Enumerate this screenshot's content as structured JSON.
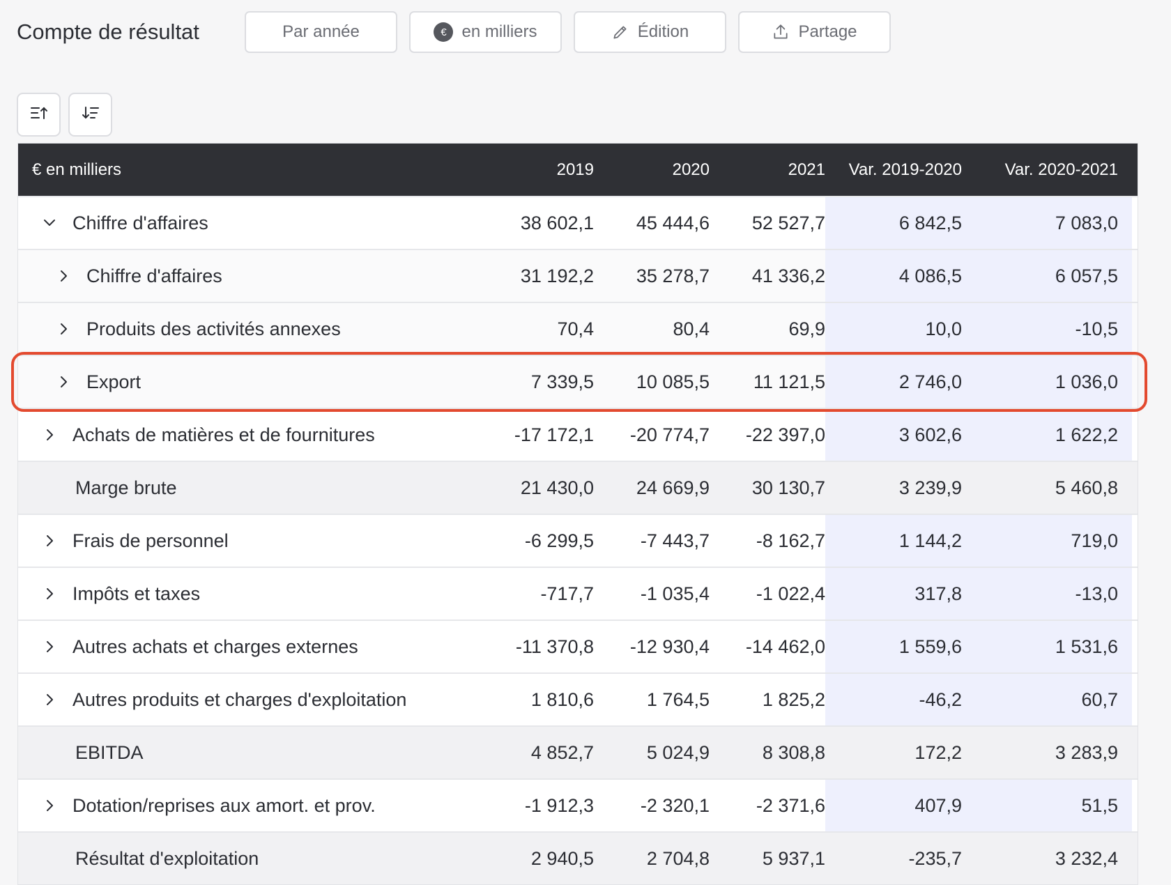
{
  "header": {
    "title": "Compte de résultat",
    "buttons": {
      "period": "Par année",
      "unit": "en milliers",
      "unit_symbol": "€",
      "edit": "Édition",
      "share": "Partage"
    }
  },
  "sort": {
    "ascending_icon": "sort-ascending-icon",
    "descending_icon": "sort-descending-icon"
  },
  "table": {
    "columns": [
      "€ en milliers",
      "2019",
      "2020",
      "2021",
      "Var. 2019-2020",
      "Var. 2020-2021"
    ],
    "rows": [
      {
        "label": "Chiffre d'affaires",
        "v": [
          "38 602,1",
          "45 444,6",
          "52 527,7",
          "6 842,5",
          "7 083,0"
        ]
      },
      {
        "label": "Chiffre d'affaires",
        "v": [
          "31 192,2",
          "35 278,7",
          "41 336,2",
          "4 086,5",
          "6 057,5"
        ]
      },
      {
        "label": "Produits des activités annexes",
        "v": [
          "70,4",
          "80,4",
          "69,9",
          "10,0",
          "-10,5"
        ]
      },
      {
        "label": "Export",
        "v": [
          "7 339,5",
          "10 085,5",
          "11 121,5",
          "2 746,0",
          "1 036,0"
        ]
      },
      {
        "label": "Achats de matières et de fournitures",
        "v": [
          "-17 172,1",
          "-20 774,7",
          "-22 397,0",
          "3 602,6",
          "1 622,2"
        ]
      },
      {
        "label": "Marge brute",
        "v": [
          "21 430,0",
          "24 669,9",
          "30 130,7",
          "3 239,9",
          "5 460,8"
        ]
      },
      {
        "label": "Frais de personnel",
        "v": [
          "-6 299,5",
          "-7 443,7",
          "-8 162,7",
          "1 144,2",
          "719,0"
        ]
      },
      {
        "label": "Impôts et taxes",
        "v": [
          "-717,7",
          "-1 035,4",
          "-1 022,4",
          "317,8",
          "-13,0"
        ]
      },
      {
        "label": "Autres achats et charges externes",
        "v": [
          "-11 370,8",
          "-12 930,4",
          "-14 462,0",
          "1 559,6",
          "1 531,6"
        ]
      },
      {
        "label": "Autres produits et charges d'exploitation",
        "v": [
          "1 810,6",
          "1 764,5",
          "1 825,2",
          "-46,2",
          "60,7"
        ]
      },
      {
        "label": "EBITDA",
        "v": [
          "4 852,7",
          "5 024,9",
          "8 308,8",
          "172,2",
          "3 283,9"
        ]
      },
      {
        "label": "Dotation/reprises aux amort. et prov.",
        "v": [
          "-1 912,3",
          "-2 320,1",
          "-2 371,6",
          "407,9",
          "51,5"
        ]
      },
      {
        "label": "Résultat d'exploitation",
        "v": [
          "2 940,5",
          "2 704,8",
          "5 937,1",
          "-235,7",
          "3 232,4"
        ]
      }
    ]
  },
  "colors": {
    "header_bg": "#2f3035",
    "variance_bg": "#eef0fd",
    "highlight": "#e34a2f"
  }
}
